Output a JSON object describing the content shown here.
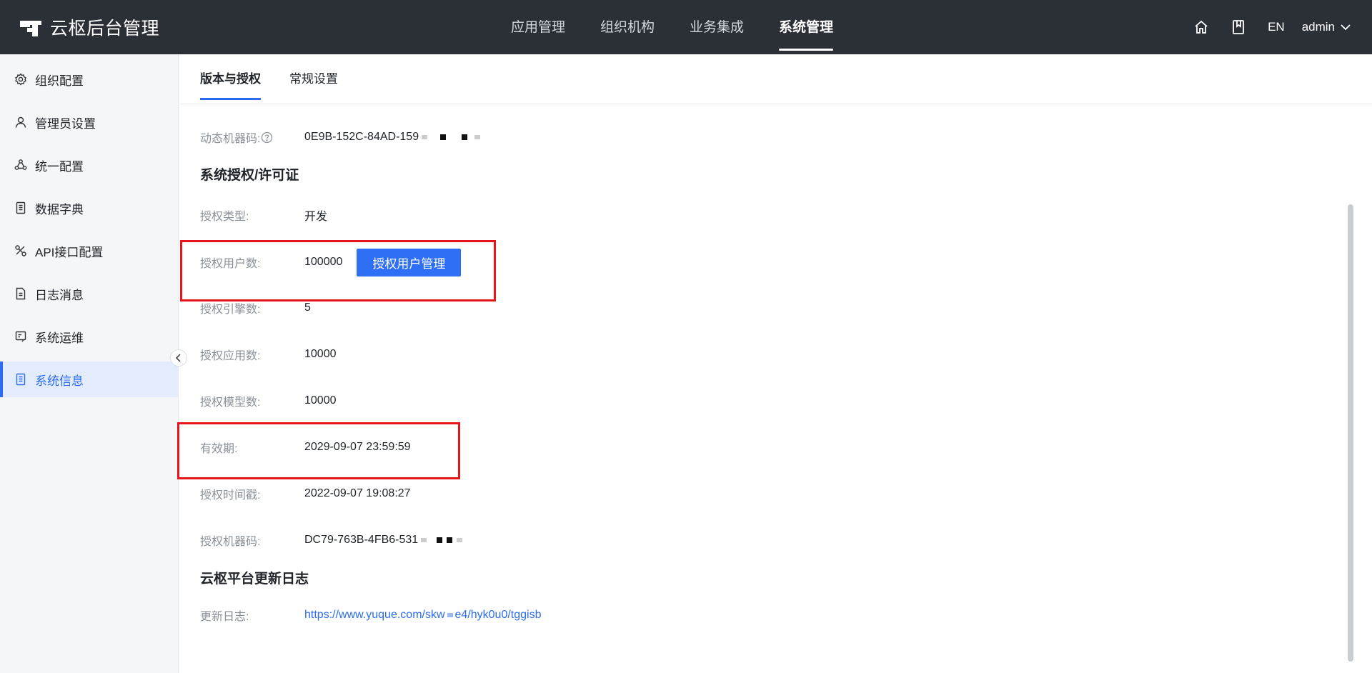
{
  "header": {
    "brand": "云枢后台管理",
    "nav": [
      {
        "label": "应用管理",
        "active": false
      },
      {
        "label": "组织机构",
        "active": false
      },
      {
        "label": "业务集成",
        "active": false
      },
      {
        "label": "系统管理",
        "active": true
      }
    ],
    "lang": "EN",
    "user": "admin"
  },
  "sidebar": {
    "items": [
      {
        "label": "组织配置",
        "icon": "gear-icon",
        "active": false
      },
      {
        "label": "管理员设置",
        "icon": "user-icon",
        "active": false
      },
      {
        "label": "统一配置",
        "icon": "cluster-icon",
        "active": false
      },
      {
        "label": "数据字典",
        "icon": "dictionary-icon",
        "active": false
      },
      {
        "label": "API接口配置",
        "icon": "api-icon",
        "active": false
      },
      {
        "label": "日志消息",
        "icon": "log-icon",
        "active": false
      },
      {
        "label": "系统运维",
        "icon": "ops-icon",
        "active": false
      },
      {
        "label": "系统信息",
        "icon": "info-icon",
        "active": true
      }
    ]
  },
  "tabs": [
    {
      "label": "版本与授权",
      "active": true
    },
    {
      "label": "常规设置",
      "active": false
    }
  ],
  "info": {
    "dynamic_machine_code_label": "动态机器码:",
    "dynamic_machine_code_value": "0E9B-152C-84AD-159",
    "license_section_title": "系统授权/许可证",
    "license_type_label": "授权类型:",
    "license_type_value": "开发",
    "license_users_label": "授权用户数:",
    "license_users_value": "100000",
    "manage_users_button": "授权用户管理",
    "license_engines_label": "授权引擎数:",
    "license_engines_value": "5",
    "license_apps_label": "授权应用数:",
    "license_apps_value": "10000",
    "license_models_label": "授权模型数:",
    "license_models_value": "10000",
    "validity_label": "有效期:",
    "validity_value": "2029-09-07 23:59:59",
    "timestamp_label": "授权时间戳:",
    "timestamp_value": "2022-09-07 19:08:27",
    "machine_code_label": "授权机器码:",
    "machine_code_value": "DC79-763B-4FB6-531",
    "changelog_section_title": "云枢平台更新日志",
    "changelog_label": "更新日志:",
    "changelog_link": "https://www.yuque.com/skw",
    "changelog_link_tail": "e4/hyk0u0/tggisb"
  },
  "colors": {
    "header_bg": "#2b2f36",
    "accent": "#2c6cf0",
    "highlight_box": "#e8141c"
  }
}
